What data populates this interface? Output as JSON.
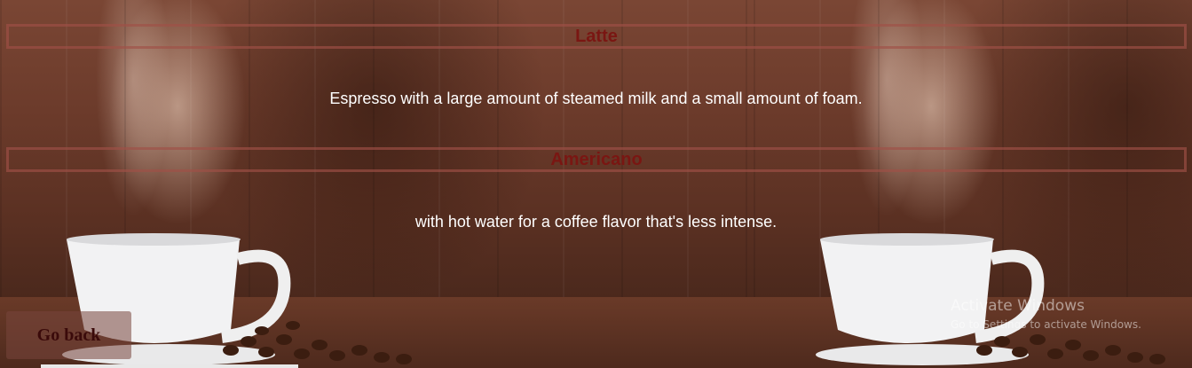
{
  "drinks": [
    {
      "name": "Latte",
      "description": "Espresso with a large amount of steamed milk and a small amount of foam."
    },
    {
      "name": "Americano",
      "description": "with hot water for a coffee flavor that's less intense."
    }
  ],
  "back_button": {
    "label": "Go back"
  },
  "os_watermark": {
    "title": "Activate Windows",
    "subtitle": "Go to Settings to activate Windows."
  },
  "colors": {
    "heading_text": "#7a1612",
    "heading_border": "#a05046",
    "description_text": "#ffffff",
    "button_text": "#3a0a0a"
  }
}
